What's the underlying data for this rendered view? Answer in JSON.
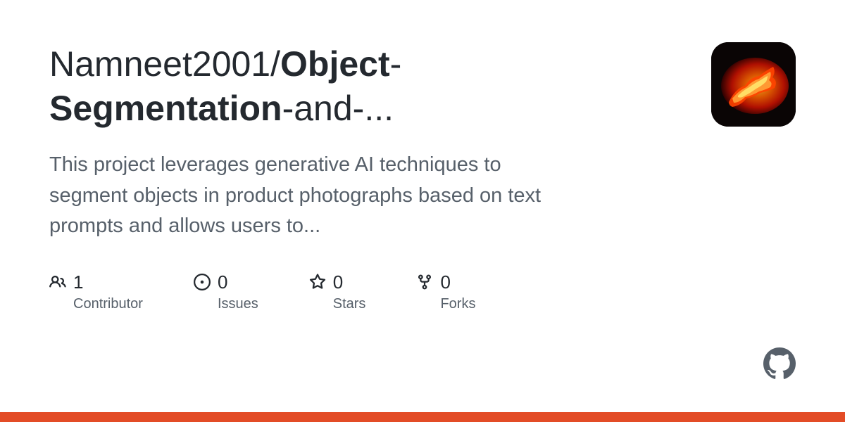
{
  "repo": {
    "owner": "Namneet2001",
    "name_part1": "Object",
    "name_part2": "Segmentation",
    "name_part3": "-and-...",
    "separator": "/"
  },
  "description": "This project leverages generative AI techniques to segment objects in product photographs based on text prompts and allows users to...",
  "stats": {
    "contributors": {
      "value": "1",
      "label": "Contributor"
    },
    "issues": {
      "value": "0",
      "label": "Issues"
    },
    "stars": {
      "value": "0",
      "label": "Stars"
    },
    "forks": {
      "value": "0",
      "label": "Forks"
    }
  },
  "colors": {
    "primary_lang": "#e34c26"
  }
}
